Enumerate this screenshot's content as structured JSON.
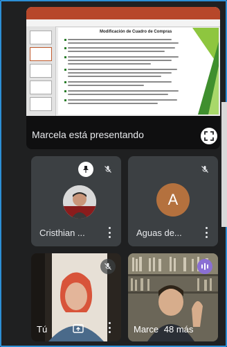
{
  "presentation": {
    "slide_title": "Modificación de Cuadro de Compras",
    "presenting_label": "Marcela está presentando"
  },
  "participants": [
    {
      "name": "Cristhian ...",
      "avatar": "photo",
      "pinned": true,
      "muted": true
    },
    {
      "name": "Aguas de...",
      "avatar_letter": "A",
      "avatar_color": "#b4713e",
      "muted": true
    },
    {
      "name": "Tú",
      "video": true,
      "muted": true,
      "presenting": true
    },
    {
      "name": "Marce",
      "video": true,
      "speaking": true,
      "others_label": "48 más"
    }
  ],
  "colors": {
    "border": "#2c8fd6",
    "tile_bg": "#3c4043",
    "speaking": "#8a6fd4"
  },
  "icons": [
    "pin-icon",
    "mic-off-icon",
    "fullscreen-icon",
    "more-vert-icon",
    "present-screen-icon",
    "audio-levels-icon"
  ]
}
